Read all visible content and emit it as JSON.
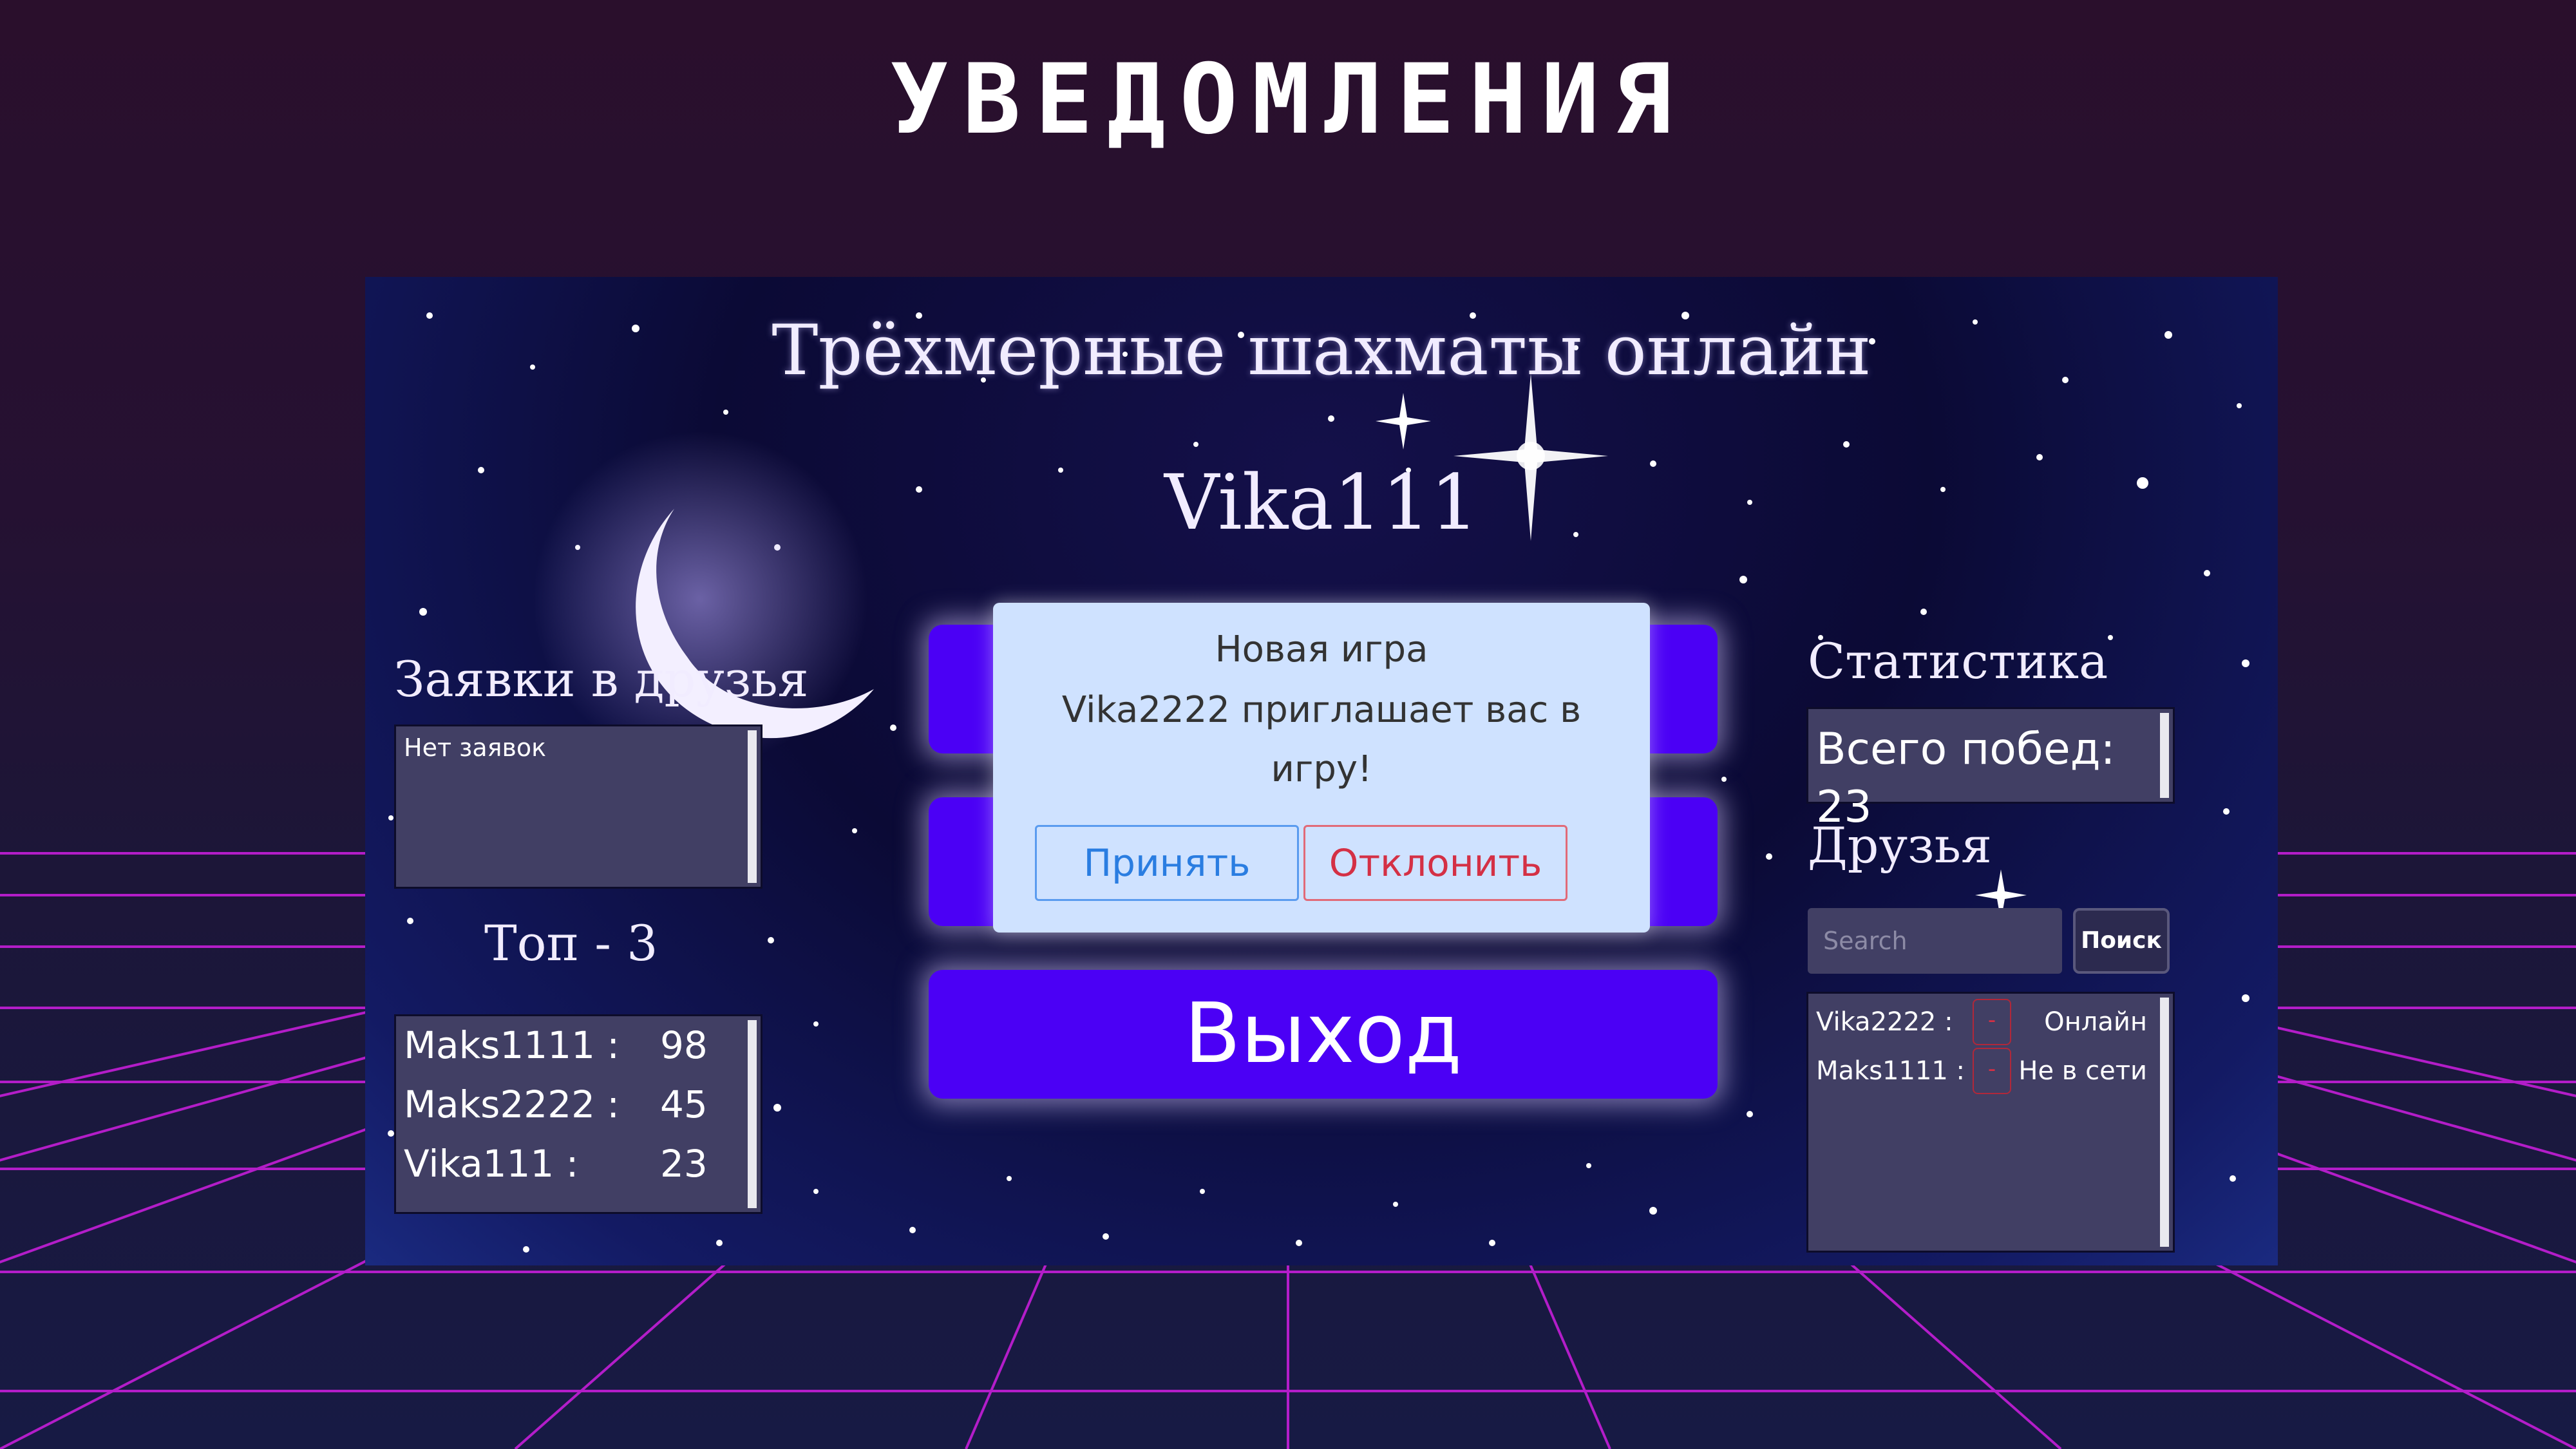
{
  "slide": {
    "title": "УВЕДОМЛЕНИЯ"
  },
  "app": {
    "title": "Трёхмерные шахматы онлайн",
    "username": "Vika111",
    "friend_requests": {
      "title": "Заявки в друзья",
      "empty_text": "Нет заявок"
    },
    "top3": {
      "title": "Топ - 3",
      "rows": [
        {
          "name": "Maks1111 :",
          "score": "98"
        },
        {
          "name": "Maks2222 :",
          "score": "45"
        },
        {
          "name": "Vika111 :",
          "score": "23"
        }
      ]
    },
    "statistics": {
      "title": "Статистика",
      "wins_text": "Всего побед: 23"
    },
    "friends": {
      "title": "Друзья",
      "search_placeholder": "Search",
      "search_button": "Поиск",
      "remove_label": "-",
      "rows": [
        {
          "name": "Vika2222 :",
          "status": "Онлайн"
        },
        {
          "name": "Maks1111 :",
          "status": "Не в сети"
        }
      ]
    },
    "exit_button": "Выход",
    "dialog": {
      "line1": "Новая игра",
      "line2": "Vika2222 приглашает вас в",
      "line3": "игру!",
      "accept": "Принять",
      "decline": "Отклонить"
    }
  },
  "colors": {
    "accent_button": "#4b00f5",
    "dialog_bg": "#cfe2ff",
    "accept": "#2a7de1",
    "decline": "#d43045",
    "grid": "#d020e0"
  }
}
